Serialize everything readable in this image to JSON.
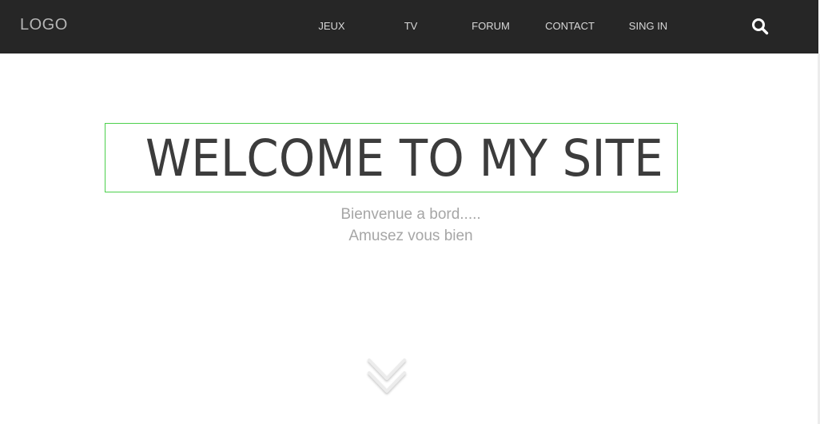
{
  "navbar": {
    "logo": "LOGO",
    "items": [
      {
        "label": "JEUX"
      },
      {
        "label": "TV"
      },
      {
        "label": "FORUM"
      },
      {
        "label": "CONTACT"
      },
      {
        "label": "SING IN"
      }
    ],
    "search_icon": "search-icon"
  },
  "hero": {
    "title": "WELCOME TO MY SITE",
    "subtitle_line1": "Bienvenue a bord.....",
    "subtitle_line2": "Amusez vous bien"
  },
  "scroll_icon": "chevron-double-down-icon",
  "colors": {
    "navbar_bg": "#262626",
    "selection_border": "#4cd04c",
    "title": "#3c3c3c",
    "subtitle": "#a6a6a6"
  }
}
